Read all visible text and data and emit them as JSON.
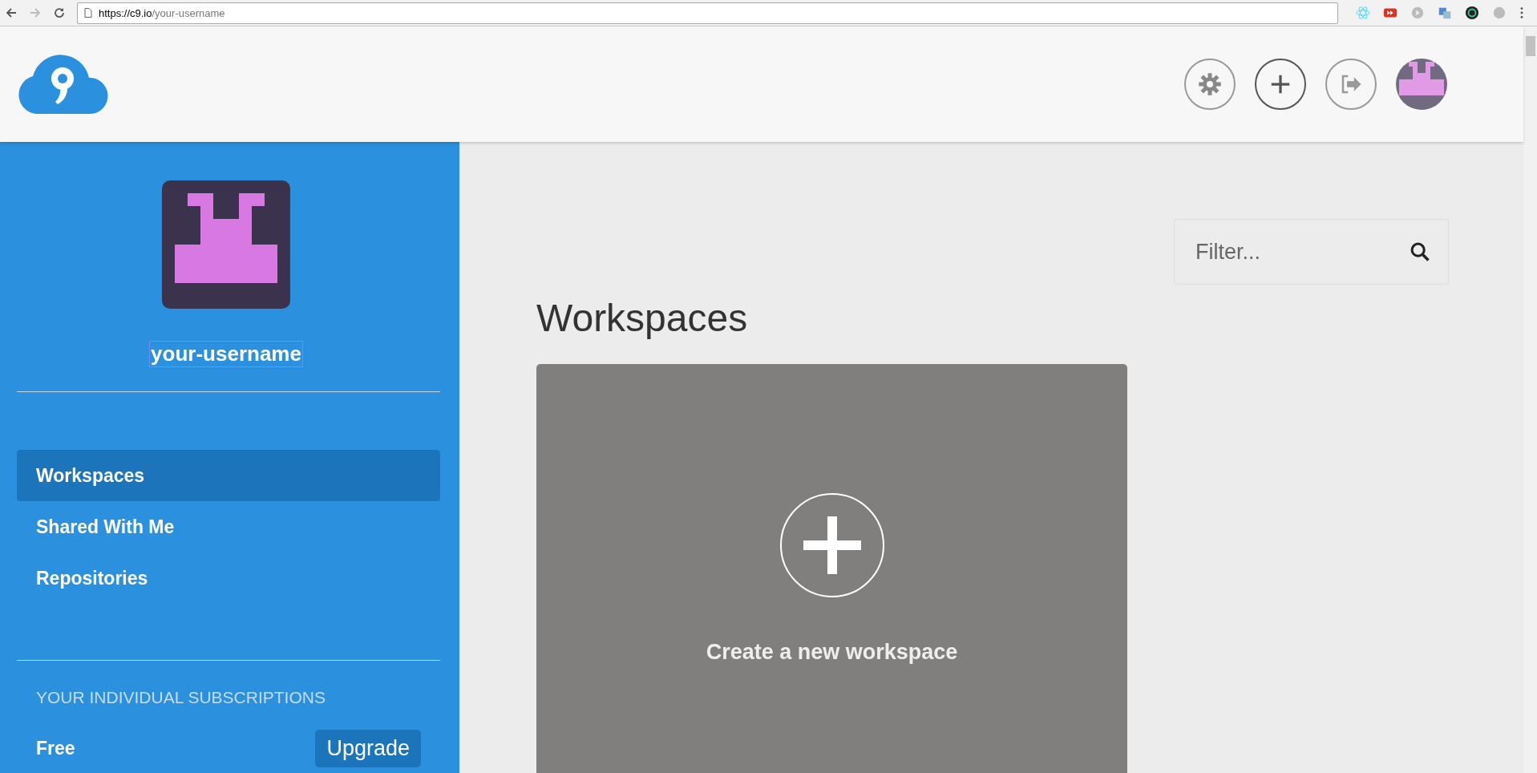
{
  "browser": {
    "url_host": "https://c9.io",
    "url_path": "/your-username"
  },
  "sidebar": {
    "username": "your-username",
    "nav": [
      {
        "label": "Workspaces",
        "selected": true
      },
      {
        "label": "Shared With Me",
        "selected": false
      },
      {
        "label": "Repositories",
        "selected": false
      }
    ],
    "subscriptions": {
      "heading": "YOUR INDIVIDUAL SUBSCRIPTIONS",
      "plan": "Free",
      "button": "Upgrade"
    }
  },
  "main": {
    "filter": {
      "placeholder": "Filter..."
    },
    "heading": "Workspaces",
    "new_card": {
      "label": "Create a new workspace"
    }
  }
}
